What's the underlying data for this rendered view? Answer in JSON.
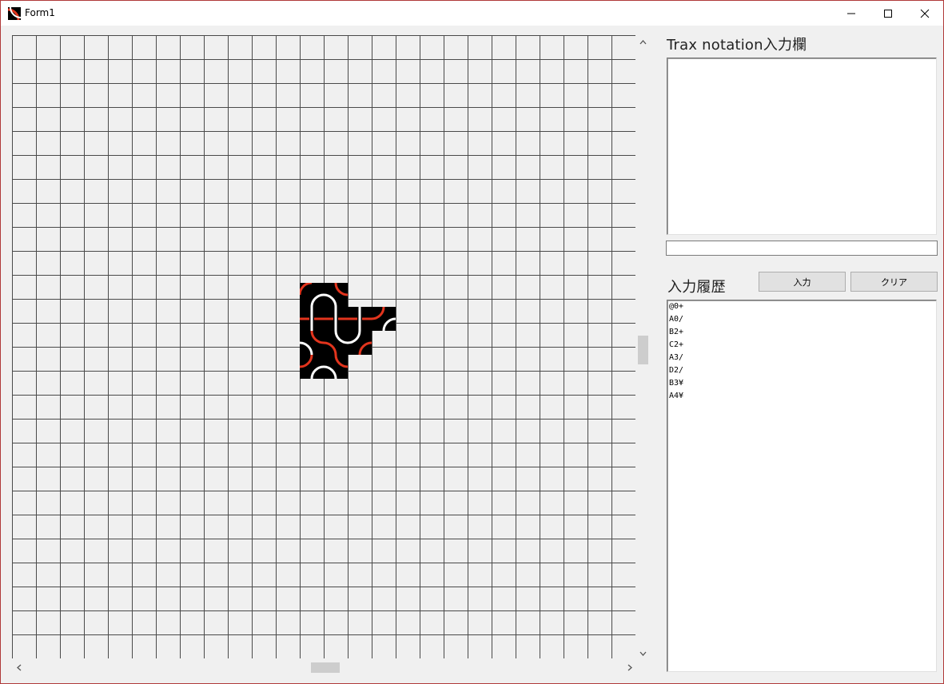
{
  "window": {
    "title": "Form1",
    "controls": {
      "minimize": "─",
      "maximize": "☐",
      "close": "✕"
    },
    "accent_border": "#b03a3a"
  },
  "board": {
    "grid_cols": 26,
    "grid_rows": 26,
    "tile_bg": "#000000",
    "red": "#e2341d",
    "white": "#ffffff"
  },
  "notation_panel": {
    "label": "Trax notation入力欄",
    "textarea_value": "",
    "input_value": ""
  },
  "history_panel": {
    "label": "入力履歴",
    "submit_button": "入力",
    "clear_button": "クリア",
    "entries": [
      "@0+",
      "A0/",
      "B2+",
      "C2+",
      "A3/",
      "D2/",
      "B3¥",
      "A4¥"
    ]
  },
  "icons": {
    "app": "trax-app-icon",
    "scroll_up": "chevron-up-icon",
    "scroll_down": "chevron-down-icon",
    "scroll_left": "chevron-left-icon",
    "scroll_right": "chevron-right-icon"
  }
}
